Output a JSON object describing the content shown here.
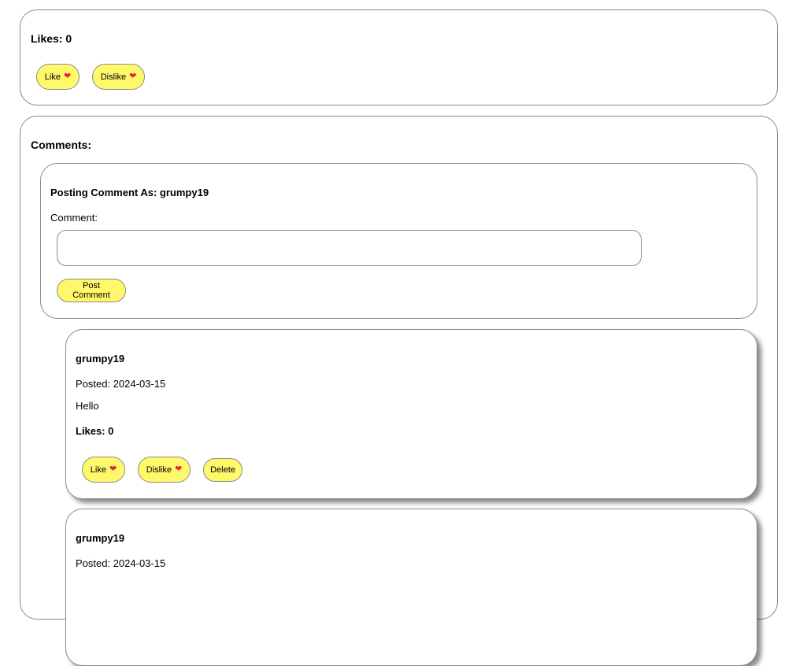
{
  "post": {
    "likes_label": "Likes: 0",
    "like_label": "Like",
    "dislike_label": "Dislike"
  },
  "comments": {
    "heading": "Comments:",
    "composer": {
      "posting_as": "Posting Comment As: grumpy19",
      "comment_label": "Comment:",
      "comment_value": "",
      "comment_placeholder": "",
      "post_button": "Post Comment"
    },
    "items": [
      {
        "author": "grumpy19",
        "posted": "Posted: 2024-03-15",
        "body": "Hello",
        "likes_label": "Likes: 0",
        "like_label": "Like",
        "dislike_label": "Dislike",
        "delete_label": "Delete"
      },
      {
        "author": "grumpy19",
        "posted": "Posted: 2024-03-15"
      }
    ]
  },
  "icons": {
    "like": "heart-icon",
    "dislike": "broken-heart-icon"
  },
  "colors": {
    "button_fill": "#fff86a",
    "border": "#8a8a8a",
    "heart": "#e8233b"
  }
}
